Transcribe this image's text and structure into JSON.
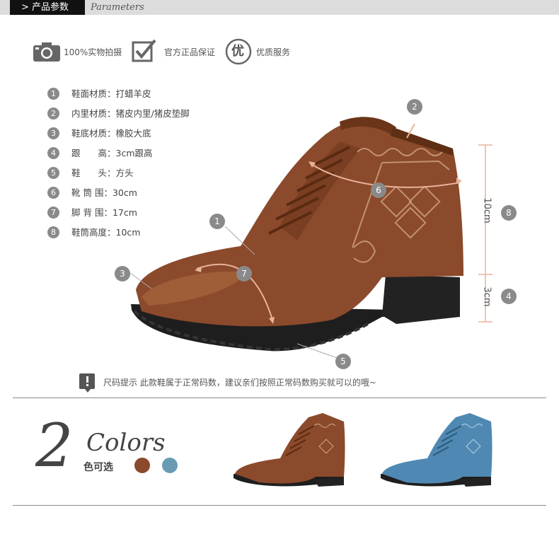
{
  "header": {
    "tab_label": "> 产品参数",
    "english_label": "Parameters"
  },
  "badges": [
    {
      "icon": "camera-icon",
      "label": "100%实物拍摄"
    },
    {
      "icon": "checkmark-icon",
      "label": "官方正品保证"
    },
    {
      "icon": "quality-seal-icon",
      "glyph": "优",
      "label": "优质服务"
    }
  ],
  "specs": [
    {
      "num": "1",
      "text": "鞋面材质：打蜡羊皮"
    },
    {
      "num": "2",
      "text": "内里材质：猪皮内里/猪皮垫脚"
    },
    {
      "num": "3",
      "text": "鞋底材质：橡胶大底"
    },
    {
      "num": "4",
      "text": "跟　　高：3cm跟高"
    },
    {
      "num": "5",
      "text": "鞋　　头：方头"
    },
    {
      "num": "6",
      "text": "靴 筒 围：30cm"
    },
    {
      "num": "7",
      "text": "脚 背 围：17cm"
    },
    {
      "num": "8",
      "text": "鞋筒高度：10cm"
    }
  ],
  "markers": [
    "1",
    "2",
    "3",
    "4",
    "5",
    "6",
    "7",
    "8"
  ],
  "dimensions": {
    "shaft_height": "10cm",
    "heel_height": "3cm"
  },
  "tip": {
    "text": "尺码提示 此款鞋属于正常码数，建议亲们按照正常码数购买就可以的哦~"
  },
  "colors_section": {
    "big_number": "2",
    "word": "Colors",
    "cn_label": "色可选",
    "swatches": [
      "#8b4a2b",
      "#6a9bb4"
    ]
  },
  "colors": {
    "brown_leather": "#8b4a2b",
    "blue_leather": "#4f89b3",
    "marker_gray": "#8a8a8a",
    "arrow": "#e8b39a"
  }
}
